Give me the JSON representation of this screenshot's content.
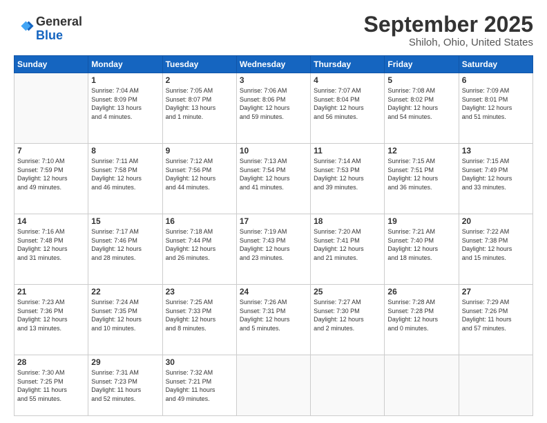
{
  "logo": {
    "line1": "General",
    "line2": "Blue"
  },
  "header": {
    "month": "September 2025",
    "location": "Shiloh, Ohio, United States"
  },
  "weekdays": [
    "Sunday",
    "Monday",
    "Tuesday",
    "Wednesday",
    "Thursday",
    "Friday",
    "Saturday"
  ],
  "rows": [
    [
      {
        "day": "",
        "info": ""
      },
      {
        "day": "1",
        "info": "Sunrise: 7:04 AM\nSunset: 8:09 PM\nDaylight: 13 hours\nand 4 minutes."
      },
      {
        "day": "2",
        "info": "Sunrise: 7:05 AM\nSunset: 8:07 PM\nDaylight: 13 hours\nand 1 minute."
      },
      {
        "day": "3",
        "info": "Sunrise: 7:06 AM\nSunset: 8:06 PM\nDaylight: 12 hours\nand 59 minutes."
      },
      {
        "day": "4",
        "info": "Sunrise: 7:07 AM\nSunset: 8:04 PM\nDaylight: 12 hours\nand 56 minutes."
      },
      {
        "day": "5",
        "info": "Sunrise: 7:08 AM\nSunset: 8:02 PM\nDaylight: 12 hours\nand 54 minutes."
      },
      {
        "day": "6",
        "info": "Sunrise: 7:09 AM\nSunset: 8:01 PM\nDaylight: 12 hours\nand 51 minutes."
      }
    ],
    [
      {
        "day": "7",
        "info": "Sunrise: 7:10 AM\nSunset: 7:59 PM\nDaylight: 12 hours\nand 49 minutes."
      },
      {
        "day": "8",
        "info": "Sunrise: 7:11 AM\nSunset: 7:58 PM\nDaylight: 12 hours\nand 46 minutes."
      },
      {
        "day": "9",
        "info": "Sunrise: 7:12 AM\nSunset: 7:56 PM\nDaylight: 12 hours\nand 44 minutes."
      },
      {
        "day": "10",
        "info": "Sunrise: 7:13 AM\nSunset: 7:54 PM\nDaylight: 12 hours\nand 41 minutes."
      },
      {
        "day": "11",
        "info": "Sunrise: 7:14 AM\nSunset: 7:53 PM\nDaylight: 12 hours\nand 39 minutes."
      },
      {
        "day": "12",
        "info": "Sunrise: 7:15 AM\nSunset: 7:51 PM\nDaylight: 12 hours\nand 36 minutes."
      },
      {
        "day": "13",
        "info": "Sunrise: 7:15 AM\nSunset: 7:49 PM\nDaylight: 12 hours\nand 33 minutes."
      }
    ],
    [
      {
        "day": "14",
        "info": "Sunrise: 7:16 AM\nSunset: 7:48 PM\nDaylight: 12 hours\nand 31 minutes."
      },
      {
        "day": "15",
        "info": "Sunrise: 7:17 AM\nSunset: 7:46 PM\nDaylight: 12 hours\nand 28 minutes."
      },
      {
        "day": "16",
        "info": "Sunrise: 7:18 AM\nSunset: 7:44 PM\nDaylight: 12 hours\nand 26 minutes."
      },
      {
        "day": "17",
        "info": "Sunrise: 7:19 AM\nSunset: 7:43 PM\nDaylight: 12 hours\nand 23 minutes."
      },
      {
        "day": "18",
        "info": "Sunrise: 7:20 AM\nSunset: 7:41 PM\nDaylight: 12 hours\nand 21 minutes."
      },
      {
        "day": "19",
        "info": "Sunrise: 7:21 AM\nSunset: 7:40 PM\nDaylight: 12 hours\nand 18 minutes."
      },
      {
        "day": "20",
        "info": "Sunrise: 7:22 AM\nSunset: 7:38 PM\nDaylight: 12 hours\nand 15 minutes."
      }
    ],
    [
      {
        "day": "21",
        "info": "Sunrise: 7:23 AM\nSunset: 7:36 PM\nDaylight: 12 hours\nand 13 minutes."
      },
      {
        "day": "22",
        "info": "Sunrise: 7:24 AM\nSunset: 7:35 PM\nDaylight: 12 hours\nand 10 minutes."
      },
      {
        "day": "23",
        "info": "Sunrise: 7:25 AM\nSunset: 7:33 PM\nDaylight: 12 hours\nand 8 minutes."
      },
      {
        "day": "24",
        "info": "Sunrise: 7:26 AM\nSunset: 7:31 PM\nDaylight: 12 hours\nand 5 minutes."
      },
      {
        "day": "25",
        "info": "Sunrise: 7:27 AM\nSunset: 7:30 PM\nDaylight: 12 hours\nand 2 minutes."
      },
      {
        "day": "26",
        "info": "Sunrise: 7:28 AM\nSunset: 7:28 PM\nDaylight: 12 hours\nand 0 minutes."
      },
      {
        "day": "27",
        "info": "Sunrise: 7:29 AM\nSunset: 7:26 PM\nDaylight: 11 hours\nand 57 minutes."
      }
    ],
    [
      {
        "day": "28",
        "info": "Sunrise: 7:30 AM\nSunset: 7:25 PM\nDaylight: 11 hours\nand 55 minutes."
      },
      {
        "day": "29",
        "info": "Sunrise: 7:31 AM\nSunset: 7:23 PM\nDaylight: 11 hours\nand 52 minutes."
      },
      {
        "day": "30",
        "info": "Sunrise: 7:32 AM\nSunset: 7:21 PM\nDaylight: 11 hours\nand 49 minutes."
      },
      {
        "day": "",
        "info": ""
      },
      {
        "day": "",
        "info": ""
      },
      {
        "day": "",
        "info": ""
      },
      {
        "day": "",
        "info": ""
      }
    ]
  ]
}
